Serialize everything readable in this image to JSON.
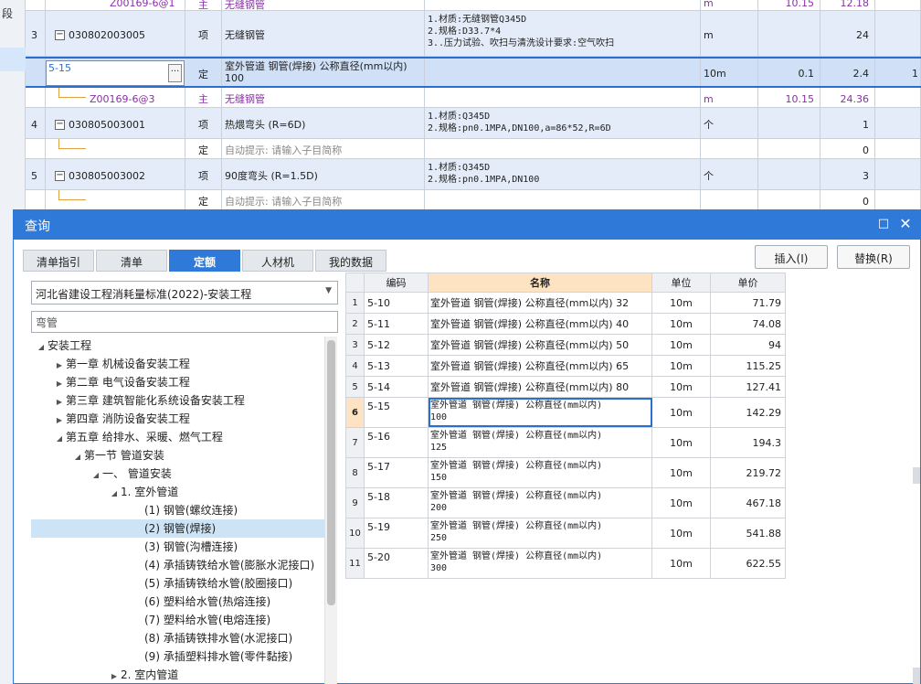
{
  "left_strip": {
    "text": "段"
  },
  "bg_rows": [
    {
      "code": "Z00169-6@1",
      "type": "主",
      "name": "无缝钢管",
      "feature": "",
      "unit": "m",
      "qty": "10.15",
      "total": "12.18"
    },
    {
      "idx": "3",
      "code": "030802003005",
      "type": "项",
      "name": "无缝钢管",
      "feature": "1.材质:无缝钢管Q345D\n2.规格:D33.7*4\n3..压力试验、吹扫与清洗设计要求:空气吹扫",
      "unit": "m",
      "qty": "",
      "total": "24"
    },
    {
      "code": "5-15",
      "type": "定",
      "name": "室外管道 钢管(焊接) 公称直径(mm以内)\n100",
      "feature": "",
      "unit": "10m",
      "qty": "0.1",
      "total": "2.4",
      "more": "···",
      "extra": "1"
    },
    {
      "code": "Z00169-6@3",
      "type": "主",
      "name": "无缝钢管",
      "feature": "",
      "unit": "m",
      "qty": "10.15",
      "total": "24.36"
    },
    {
      "idx": "4",
      "code": "030805003001",
      "type": "项",
      "name": "热煨弯头 (R=6D)",
      "feature": "1.材质:Q345D\n2.规格:pn0.1MPA,DN100,a=86*52,R=6D",
      "unit": "个",
      "qty": "",
      "total": "1"
    },
    {
      "code": "",
      "type": "定",
      "name": "自动提示: 请输入子目简称",
      "feature": "",
      "unit": "",
      "qty": "",
      "total": "0"
    },
    {
      "idx": "5",
      "code": "030805003002",
      "type": "项",
      "name": "90度弯头 (R=1.5D)",
      "feature": "1.材质:Q345D\n2.规格:pn0.1MPA,DN100",
      "unit": "个",
      "qty": "",
      "total": "3"
    },
    {
      "code": "",
      "type": "定",
      "name": "自动提示: 请输入子目简称",
      "feature": "",
      "unit": "",
      "qty": "",
      "total": "0"
    }
  ],
  "dialog": {
    "title": "查询",
    "max_icon": "□",
    "close_icon": "✕",
    "tabs": [
      "清单指引",
      "清单",
      "定额",
      "人材机",
      "我的数据"
    ],
    "insert_label": "插入(I)",
    "replace_label": "替换(R)",
    "library": "河北省建设工程消耗量标准(2022)-安装工程",
    "search_value": "弯管",
    "tree": [
      {
        "label": "安装工程",
        "arrow": "◢"
      },
      {
        "label": "第一章 机械设备安装工程",
        "arrow": "▶"
      },
      {
        "label": "第二章 电气设备安装工程",
        "arrow": "▶"
      },
      {
        "label": "第三章 建筑智能化系统设备安装工程",
        "arrow": "▶"
      },
      {
        "label": "第四章 消防设备安装工程",
        "arrow": "▶"
      },
      {
        "label": "第五章 给排水、采暖、燃气工程",
        "arrow": "◢"
      },
      {
        "label": "第一节 管道安装",
        "arrow": "◢"
      },
      {
        "label": "一、 管道安装",
        "arrow": "◢"
      },
      {
        "label": "1. 室外管道",
        "arrow": "◢"
      },
      {
        "label": "(1) 钢管(螺纹连接)",
        "arrow": ""
      },
      {
        "label": "(2) 钢管(焊接)",
        "arrow": ""
      },
      {
        "label": "(3) 钢管(沟槽连接)",
        "arrow": ""
      },
      {
        "label": "(4) 承插铸铁给水管(膨胀水泥接口)",
        "arrow": ""
      },
      {
        "label": "(5) 承插铸铁给水管(胶圈接口)",
        "arrow": ""
      },
      {
        "label": "(6) 塑料给水管(热熔连接)",
        "arrow": ""
      },
      {
        "label": "(7) 塑料给水管(电熔连接)",
        "arrow": ""
      },
      {
        "label": "(8) 承插铸铁排水管(水泥接口)",
        "arrow": ""
      },
      {
        "label": "(9) 承插塑料排水管(零件黏接)",
        "arrow": ""
      },
      {
        "label": "2. 室内管道",
        "arrow": "▶"
      }
    ],
    "table": {
      "headers": {
        "code": "编码",
        "name": "名称",
        "unit": "单位",
        "price": "单价"
      },
      "rows": [
        {
          "idx": "1",
          "code": "5-10",
          "name": "室外管道 钢管(焊接) 公称直径(mm以内) 32",
          "unit": "10m",
          "price": "71.79"
        },
        {
          "idx": "2",
          "code": "5-11",
          "name": "室外管道 钢管(焊接) 公称直径(mm以内) 40",
          "unit": "10m",
          "price": "74.08"
        },
        {
          "idx": "3",
          "code": "5-12",
          "name": "室外管道 钢管(焊接) 公称直径(mm以内) 50",
          "unit": "10m",
          "price": "94"
        },
        {
          "idx": "4",
          "code": "5-13",
          "name": "室外管道 钢管(焊接) 公称直径(mm以内) 65",
          "unit": "10m",
          "price": "115.25"
        },
        {
          "idx": "5",
          "code": "5-14",
          "name": "室外管道 钢管(焊接) 公称直径(mm以内) 80",
          "unit": "10m",
          "price": "127.41"
        },
        {
          "idx": "6",
          "code": "5-15",
          "name": "室外管道 钢管(焊接) 公称直径(mm以内)\n100",
          "unit": "10m",
          "price": "142.29"
        },
        {
          "idx": "7",
          "code": "5-16",
          "name": "室外管道 钢管(焊接) 公称直径(mm以内)\n125",
          "unit": "10m",
          "price": "194.3"
        },
        {
          "idx": "8",
          "code": "5-17",
          "name": "室外管道 钢管(焊接) 公称直径(mm以内)\n150",
          "unit": "10m",
          "price": "219.72"
        },
        {
          "idx": "9",
          "code": "5-18",
          "name": "室外管道 钢管(焊接) 公称直径(mm以内)\n200",
          "unit": "10m",
          "price": "467.18"
        },
        {
          "idx": "10",
          "code": "5-19",
          "name": "室外管道 钢管(焊接) 公称直径(mm以内)\n250",
          "unit": "10m",
          "price": "541.88"
        },
        {
          "idx": "11",
          "code": "5-20",
          "name": "室外管道 钢管(焊接) 公称直径(mm以内)\n300",
          "unit": "10m",
          "price": "622.55"
        }
      ]
    }
  },
  "colors": {
    "accent": "#2f7ad8",
    "selected_row": "#cfe0f7",
    "header_highlight": "#fde3c2",
    "purple_text": "#8a2fa8"
  }
}
